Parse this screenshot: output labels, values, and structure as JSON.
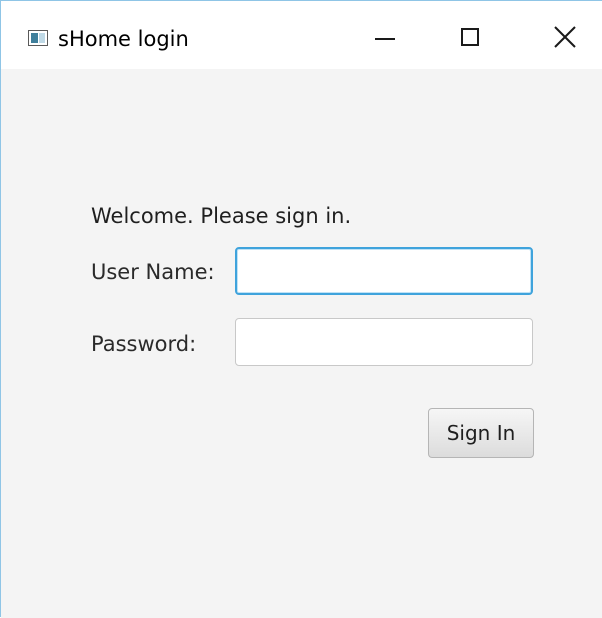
{
  "window": {
    "title": "sHome login",
    "icon": "app-window-icon",
    "controls": {
      "minimize_icon": "minimize-icon",
      "maximize_icon": "maximize-icon",
      "close_icon": "close-icon"
    },
    "accent_color": "#3fa3dc",
    "background_color": "#f4f4f4"
  },
  "login": {
    "welcome": "Welcome. Please sign in.",
    "username_label": "User Name:",
    "username_value": "",
    "password_label": "Password:",
    "password_value": "",
    "signin_label": "Sign In"
  }
}
